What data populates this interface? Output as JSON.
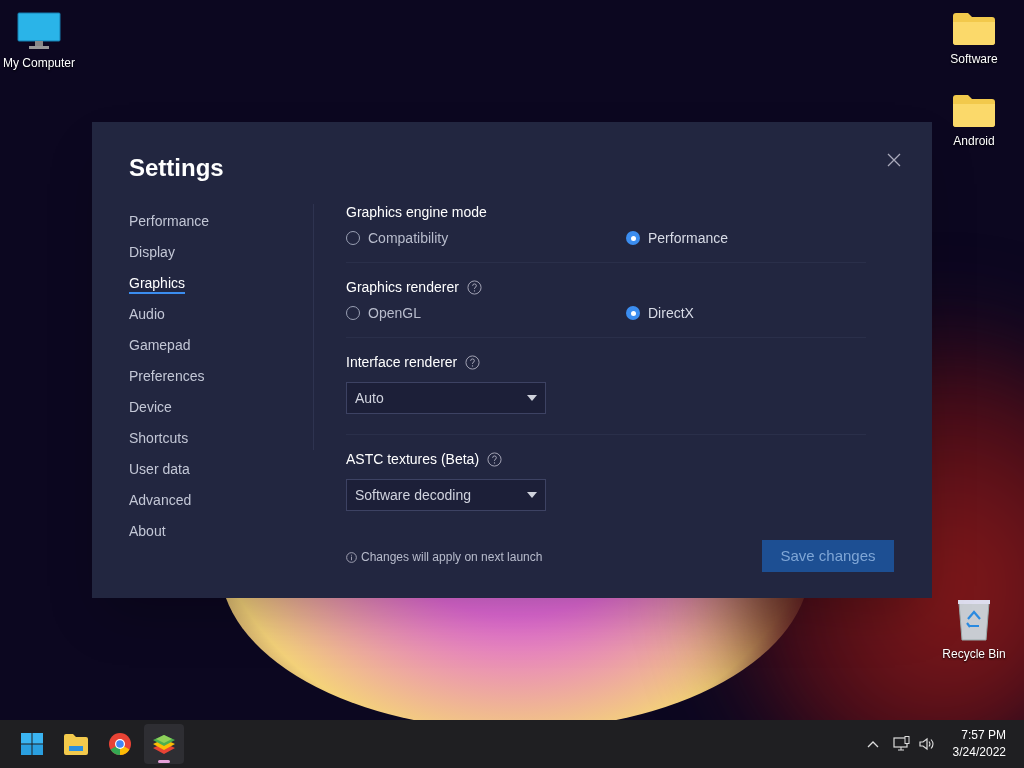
{
  "desktop": {
    "left_icons": [
      {
        "label": "My Computer",
        "kind": "computer"
      }
    ],
    "right_top_icons": [
      {
        "label": "Software",
        "kind": "folder"
      },
      {
        "label": "Android",
        "kind": "folder"
      }
    ],
    "right_bottom_icons": [
      {
        "label": "Recycle Bin",
        "kind": "recycle"
      }
    ]
  },
  "settings": {
    "title": "Settings",
    "nav": [
      {
        "label": "Performance",
        "selected": false
      },
      {
        "label": "Display",
        "selected": false
      },
      {
        "label": "Graphics",
        "selected": true
      },
      {
        "label": "Audio",
        "selected": false
      },
      {
        "label": "Gamepad",
        "selected": false
      },
      {
        "label": "Preferences",
        "selected": false
      },
      {
        "label": "Device",
        "selected": false
      },
      {
        "label": "Shortcuts",
        "selected": false
      },
      {
        "label": "User data",
        "selected": false
      },
      {
        "label": "Advanced",
        "selected": false
      },
      {
        "label": "About",
        "selected": false
      }
    ],
    "sections": [
      {
        "kind": "radio",
        "label": "Graphics engine mode",
        "help": false,
        "options": [
          {
            "label": "Compatibility",
            "selected": false
          },
          {
            "label": "Performance",
            "selected": true
          }
        ]
      },
      {
        "kind": "radio",
        "label": "Graphics renderer",
        "help": true,
        "options": [
          {
            "label": "OpenGL",
            "selected": false
          },
          {
            "label": "DirectX",
            "selected": true
          }
        ]
      },
      {
        "kind": "select",
        "label": "Interface renderer",
        "help": true,
        "value": "Auto"
      },
      {
        "kind": "select",
        "label": "ASTC textures (Beta)",
        "help": true,
        "value": "Software decoding"
      }
    ],
    "note": "Changes will apply on next launch",
    "save_button": {
      "label": "Save changes",
      "disabled": true
    }
  },
  "taskbar": {
    "apps": [
      {
        "kind": "start",
        "active": false
      },
      {
        "kind": "explorer",
        "active": false
      },
      {
        "kind": "browser",
        "active": false
      },
      {
        "kind": "emulator",
        "active": true
      }
    ],
    "time": "7:57 PM",
    "date": "3/24/2022"
  }
}
